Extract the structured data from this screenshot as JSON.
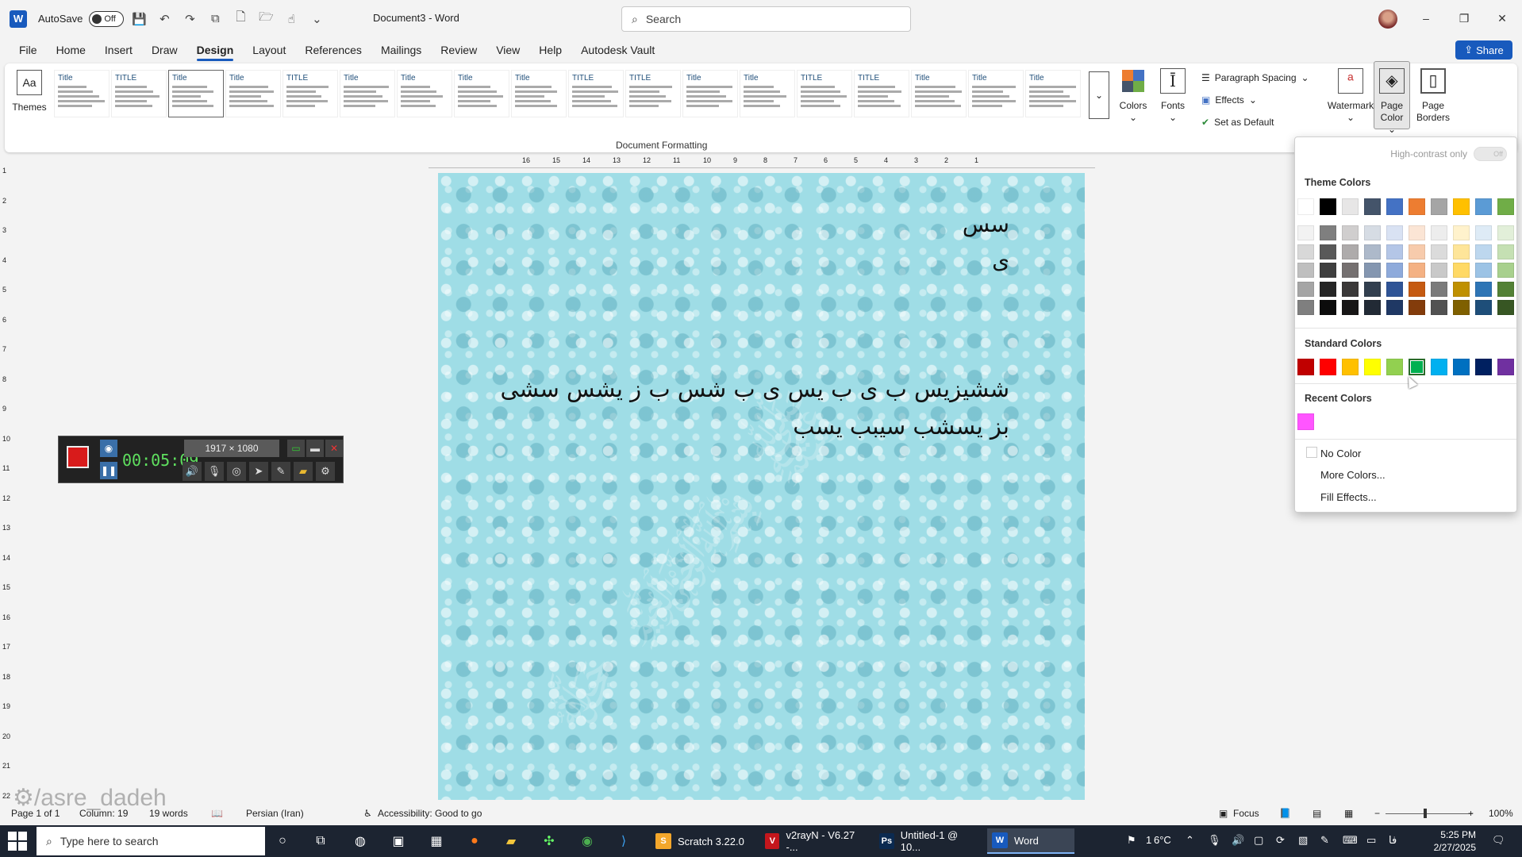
{
  "titlebar": {
    "app_logo": "W",
    "autosave_label": "AutoSave",
    "autosave_state": "Off",
    "doc_title": "Document3 - Word",
    "search_placeholder": "Search",
    "minimize": "–",
    "restore": "❐",
    "close": "✕"
  },
  "menu": {
    "items": [
      "File",
      "Home",
      "Insert",
      "Draw",
      "Design",
      "Layout",
      "References",
      "Mailings",
      "Review",
      "View",
      "Help",
      "Autodesk Vault"
    ],
    "active": "Design",
    "share_label": "Share"
  },
  "ribbon": {
    "themes_label": "Themes",
    "style_titles": [
      "Title",
      "TITLE",
      "Title",
      "Title",
      "TITLE",
      "Title",
      "Title",
      "Title",
      "Title",
      "TITLE",
      "TITLE",
      "Title",
      "Title",
      "TITLE",
      "TITLE",
      "Title",
      "Title",
      "Title"
    ],
    "group_label": "Document Formatting",
    "colors_label": "Colors",
    "fonts_label": "Fonts",
    "paragraph_spacing_label": "Paragraph Spacing",
    "effects_label": "Effects",
    "set_default_label": "Set as Default",
    "watermark_label": "Watermark",
    "page_color_label": "Page Color",
    "page_borders_label": "Page Borders"
  },
  "ruler": {
    "h_numbers": [
      "16",
      "15",
      "14",
      "13",
      "12",
      "11",
      "10",
      "9",
      "8",
      "7",
      "6",
      "5",
      "4",
      "3",
      "2",
      "1"
    ],
    "v_numbers": [
      "1",
      "2",
      "3",
      "4",
      "5",
      "6",
      "7",
      "8",
      "9",
      "10",
      "11",
      "12",
      "13",
      "14",
      "15",
      "16",
      "17",
      "18",
      "19",
      "20",
      "21",
      "22"
    ]
  },
  "document": {
    "lines": [
      "سس",
      "ی",
      "ششیزیس ب ی ب یس ی ب شس ب ز یشس سشی",
      "بز یسشب سیبب یسب"
    ]
  },
  "recorder": {
    "timer": "00:05:09",
    "resolution": "1917 × 1080"
  },
  "page_color_menu": {
    "high_contrast_label": "High-contrast only",
    "high_contrast_state": "Off",
    "theme_colors_title": "Theme Colors",
    "theme_colors_top": [
      "#FFFFFF",
      "#000000",
      "#E7E6E6",
      "#44546A",
      "#4472C4",
      "#ED7D31",
      "#A5A5A5",
      "#FFC000",
      "#5B9BD5",
      "#70AD47"
    ],
    "theme_colors_shades": [
      [
        "#F2F2F2",
        "#7F7F7F",
        "#D0CECE",
        "#D6DCE4",
        "#D9E2F3",
        "#FBE5D5",
        "#EDEDED",
        "#FFF2CC",
        "#DEEBF6",
        "#E2EFD9"
      ],
      [
        "#D8D8D8",
        "#595959",
        "#AEABAB",
        "#ADB9CA",
        "#B4C6E7",
        "#F7CBAC",
        "#DBDBDB",
        "#FEE599",
        "#BDD7EE",
        "#C5E0B3"
      ],
      [
        "#BFBFBF",
        "#3F3F3F",
        "#757070",
        "#8496B0",
        "#8EAADB",
        "#F4B183",
        "#C9C9C9",
        "#FFD965",
        "#9CC3E5",
        "#A8D08D"
      ],
      [
        "#A5A5A5",
        "#262626",
        "#3A3838",
        "#323F4F",
        "#2F5496",
        "#C55A11",
        "#7B7B7B",
        "#BF9000",
        "#2E75B5",
        "#538135"
      ],
      [
        "#7F7F7F",
        "#0C0C0C",
        "#171616",
        "#222A35",
        "#1F3864",
        "#833C0B",
        "#525252",
        "#7F6000",
        "#1E4E79",
        "#375623"
      ]
    ],
    "standard_colors_title": "Standard Colors",
    "standard_colors": [
      "#C00000",
      "#FF0000",
      "#FFC000",
      "#FFFF00",
      "#92D050",
      "#00B050",
      "#00B0F0",
      "#0070C0",
      "#002060",
      "#7030A0"
    ],
    "selected_standard_index": 5,
    "recent_colors_title": "Recent Colors",
    "recent_colors": [
      "#FF55FF"
    ],
    "no_color_label": "No Color",
    "more_colors_label": "More Colors...",
    "fill_effects_label": "Fill Effects..."
  },
  "status": {
    "page": "Page 1 of 1",
    "column": "Column: 19",
    "words": "19 words",
    "language": "Persian (Iran)",
    "accessibility": "Accessibility: Good to go",
    "focus": "Focus",
    "zoom": "100%",
    "zoom_minus": "−",
    "zoom_plus": "+"
  },
  "overlay_watermark": "/asre_dadeh",
  "taskbar": {
    "search_placeholder": "Type here to search",
    "apps": [
      {
        "label": "Scratch 3.22.0",
        "color": "#f4a72b",
        "glyph": "S"
      },
      {
        "label": "v2rayN - V6.27 -...",
        "color": "#c4161c",
        "glyph": "V"
      },
      {
        "label": "Untitled-1 @ 10...",
        "color": "#0b2a50",
        "glyph": "Ps"
      },
      {
        "label": "Word",
        "color": "#185abd",
        "glyph": "W"
      }
    ],
    "temperature": "6°C",
    "time": "5:25 PM",
    "date": "2/27/2025",
    "notification_count": "1",
    "lang_indicator": "فا"
  }
}
